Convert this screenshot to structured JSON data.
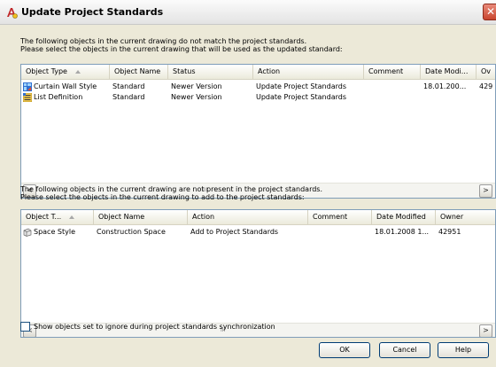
{
  "window": {
    "title": "Update Project Standards",
    "close_glyph": "✕"
  },
  "upper": {
    "intro_line1": "The following objects in the current drawing do not match the project standards.",
    "intro_line2": "Please select the objects in the current drawing that will be used as the updated standard:",
    "columns": [
      "Object Type",
      "Object Name",
      "Status",
      "Action",
      "Comment",
      "Date Modi...",
      "Ov"
    ],
    "rows": [
      {
        "icon": "curtain-wall-style-icon",
        "type": "Curtain Wall Style",
        "name": "Standard",
        "status": "Newer Version",
        "action": "Update Project Standards",
        "comment": "",
        "date": "18.01.200...",
        "owner": "429"
      },
      {
        "icon": "list-definition-icon",
        "type": "List Definition",
        "name": "Standard",
        "status": "Newer Version",
        "action": "Update Project Standards",
        "comment": "",
        "date": "",
        "owner": ""
      }
    ]
  },
  "lower": {
    "intro_line1": "The following objects in the current drawing are not present in the project standards.",
    "intro_line2": "Please select the objects in the current drawing to add to the project standards:",
    "columns": [
      "Object T...",
      "Object Name",
      "Action",
      "Comment",
      "Date Modified",
      "Owner"
    ],
    "rows": [
      {
        "icon": "space-style-icon",
        "type": "Space Style",
        "name": "Construction Space",
        "action": "Add to Project Standards",
        "comment": "",
        "date": "18.01.2008 1...",
        "owner": "42951"
      }
    ]
  },
  "scrollbar": {
    "left_glyph": "<",
    "right_glyph": ">",
    "grip": "III"
  },
  "options": {
    "show_ignored_label": "Show objects set to ignore during project standards synchronization",
    "show_ignored_checked": false
  },
  "buttons": {
    "ok": "OK",
    "cancel": "Cancel",
    "help": "Help"
  },
  "colors": {
    "dialog_bg": "#ece9d8",
    "list_border": "#7f9db9",
    "button_border": "#003c74",
    "close_red": "#c8452e"
  }
}
